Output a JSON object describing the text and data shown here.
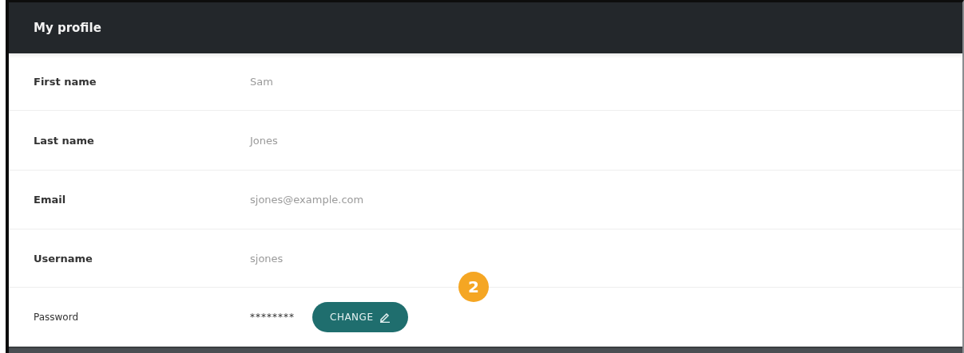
{
  "panel": {
    "title": "My profile"
  },
  "rows": [
    {
      "kind": "text",
      "label": "First name",
      "value": "Sam"
    },
    {
      "kind": "text",
      "label": "Last name",
      "value": "Jones"
    },
    {
      "kind": "text",
      "label": "Email",
      "value": "sjones@example.com"
    },
    {
      "kind": "text",
      "label": "Username",
      "value": "sjones"
    },
    {
      "kind": "password",
      "label": "Password",
      "value": "********",
      "action": "CHANGE"
    }
  ],
  "callout": {
    "number": "2"
  }
}
